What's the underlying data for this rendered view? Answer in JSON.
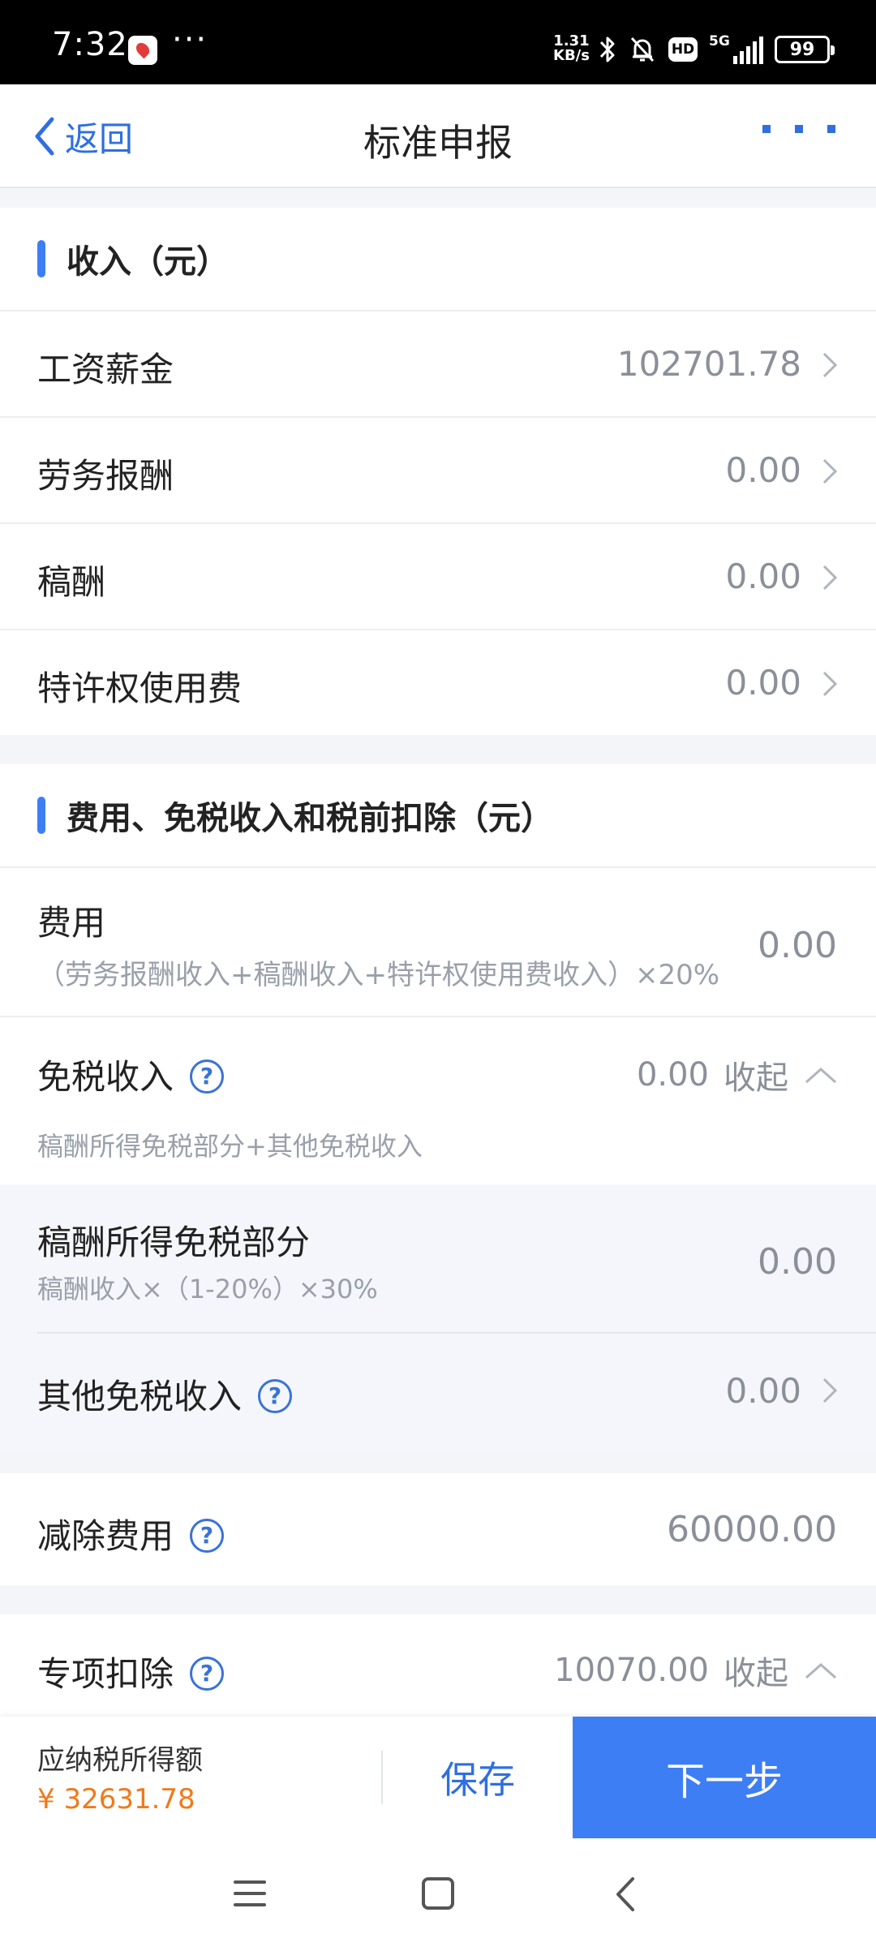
{
  "status_bar": {
    "time": "7:32",
    "more": "···",
    "net_speed_value": "1.31",
    "net_speed_unit": "KB/s",
    "hd": "HD",
    "network": "5G",
    "battery": "99"
  },
  "nav": {
    "back_label": "返回",
    "title": "标准申报"
  },
  "income": {
    "header": "收入（元）",
    "rows": [
      {
        "label": "工资薪金",
        "value": "102701.78"
      },
      {
        "label": "劳务报酬",
        "value": "0.00"
      },
      {
        "label": "稿酬",
        "value": "0.00"
      },
      {
        "label": "特许权使用费",
        "value": "0.00"
      }
    ]
  },
  "deductions": {
    "header": "费用、免税收入和税前扣除（元）",
    "expense": {
      "label": "费用",
      "formula": "（劳务报酬收入+稿酬收入+特许权使用费收入）×20%",
      "value": "0.00"
    },
    "tax_free": {
      "label": "免税收入",
      "value": "0.00",
      "toggle": "收起",
      "formula": "稿酬所得免税部分+其他免税收入"
    },
    "royalty_exempt": {
      "label": "稿酬所得免税部分",
      "formula": "稿酬收入×（1-20%）×30%",
      "value": "0.00"
    },
    "other_tax_free": {
      "label": "其他免税收入",
      "value": "0.00"
    }
  },
  "reduction": {
    "label": "减除费用",
    "value": "60000.00"
  },
  "special": {
    "label": "专项扣除",
    "value": "10070.00",
    "toggle": "收起"
  },
  "bottom": {
    "tax_label": "应纳税所得额",
    "tax_value": "¥ 32631.78",
    "save_label": "保存",
    "next_label": "下一步"
  },
  "help_glyph": "?"
}
